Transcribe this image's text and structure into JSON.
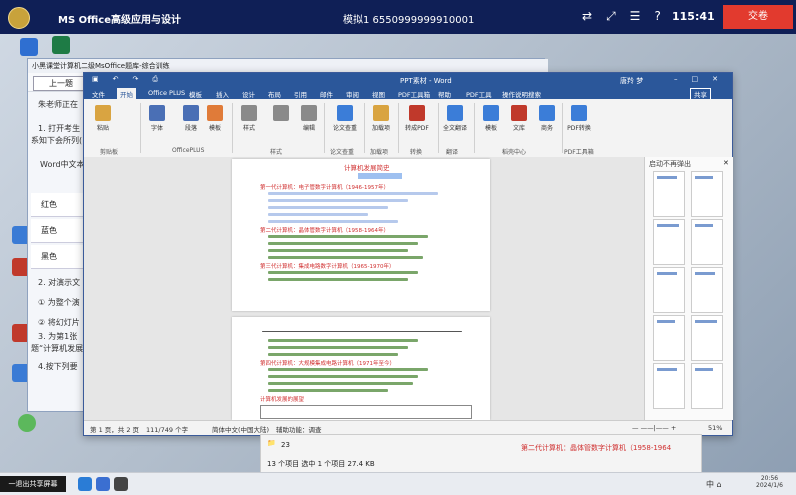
{
  "exam_bar": {
    "title": "MS Office高级应用与设计",
    "mock_label": "模拟1  6550999999910001",
    "icons": [
      "pin-icon",
      "expand-icon",
      "menu-icon",
      "help-icon"
    ],
    "icon_glyphs": [
      "⇄",
      "⤢",
      "☰",
      "?"
    ],
    "time": "115:41",
    "submit_label": "交卷"
  },
  "question_window": {
    "title": "小黑课堂计算机二级MsOffice题库-综合训练",
    "prev_button": "上一题",
    "lines": [
      "朱老师正在",
      "1. 打开考生",
      "系知下会所列(",
      "Word中文本颜",
      "2. 对演示文",
      "① 为整个演",
      "② 将幻灯片",
      "3. 为第1张",
      "题“计算机发展",
      "4.按下列要"
    ],
    "options": [
      "红色",
      "蓝色",
      "黑色"
    ]
  },
  "word": {
    "window_title": "PPT素材 - Word",
    "user": "唐羚 梦",
    "share_label": "共享",
    "tabs": [
      "文件",
      "开始",
      "Office PLUS",
      "模板",
      "插入",
      "设计",
      "布局",
      "引用",
      "邮件",
      "审阅",
      "视图",
      "PDF工具箱",
      "帮助",
      "PDF工具",
      "操作说明搜索"
    ],
    "active_tab": "开始",
    "ribbon": {
      "buttons": [
        {
          "label": "粘贴",
          "color": "#d9a441"
        },
        {
          "label": "字体",
          "color": "#4a6fb5"
        },
        {
          "label": "段落",
          "color": "#4a6fb5"
        },
        {
          "label": "模板",
          "color": "#e07b39"
        },
        {
          "label": "样式",
          "color": "#6b6b6b"
        },
        {
          "label": "编辑",
          "color": "#6b6b6b"
        },
        {
          "label": "论文查重",
          "color": "#3b7dd8"
        },
        {
          "label": "加载项",
          "color": "#d9a441"
        },
        {
          "label": "转成PDF",
          "color": "#c0392b"
        },
        {
          "label": "全文翻译",
          "color": "#3b7dd8"
        },
        {
          "label": "模板",
          "color": "#3b7dd8"
        },
        {
          "label": "文库",
          "color": "#c0392b"
        },
        {
          "label": "商务",
          "color": "#3b7dd8"
        },
        {
          "label": "PDF转换",
          "color": "#3b7dd8"
        }
      ],
      "groups": [
        "剪贴板",
        "OfficePLUS",
        "样式",
        "论文查重",
        "加载项",
        "转换",
        "翻译",
        "稻壳中心",
        "PDF工具箱"
      ]
    },
    "document": {
      "heading": "计算机发展简史",
      "sections": [
        "第一代计算机：电子管数字计算机（1946-1957年）",
        "第二代计算机：晶体管数字计算机（1958-1964年）",
        "第三代计算机：集成电路数字计算机（1965-1970年）",
        "第四代计算机：大规模集成电路计算机（1971年至今）",
        "计算机发展的展望"
      ]
    },
    "side_pane": {
      "title": "启动不再弹出",
      "thumbs": 10
    },
    "status": {
      "page": "第 1 页，共 2 页",
      "words": "111/749 个字",
      "lang": "简体中文(中国大陆)",
      "accessibility": "辅助功能：调查",
      "zoom": "51%"
    }
  },
  "explorer": {
    "folder_count": "23",
    "items_summary": "13 个项目    选中 1 个项目  27.4 KB",
    "highlight": "第二代计算机：晶体管数字计算机（1958-1964"
  },
  "taskbar": {
    "share_label": "一退出共享屏幕",
    "tray": "中  ⌂",
    "time": "20:56",
    "date": "2024/1/6"
  }
}
